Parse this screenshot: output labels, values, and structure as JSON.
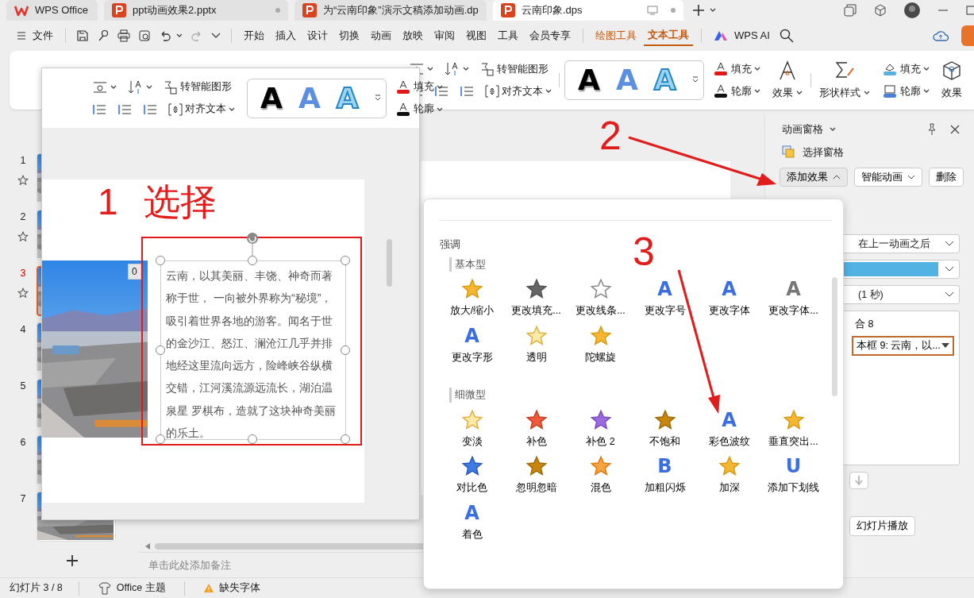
{
  "tabs": [
    {
      "label": "WPS Office",
      "kind": "home",
      "selected": false
    },
    {
      "label": "ppt动画效果2.pptx",
      "kind": "doc",
      "selected": false
    },
    {
      "label": "为“云南印象”演示文稿添加动画.dp",
      "kind": "doc",
      "selected": false
    },
    {
      "label": "云南印象.dps",
      "kind": "doc",
      "selected": true
    }
  ],
  "menu": {
    "file": "文件",
    "quick_access": [
      {
        "kind": "save",
        "disabled": false
      },
      {
        "kind": "key",
        "disabled": false
      },
      {
        "kind": "print",
        "disabled": false
      },
      {
        "kind": "preview",
        "disabled": false
      },
      {
        "kind": "undo",
        "disabled": false
      },
      {
        "kind": "redo",
        "disabled": true
      }
    ],
    "items": [
      {
        "label": "开始",
        "kind": "main",
        "selected": false
      },
      {
        "label": "插入",
        "kind": "main",
        "selected": false
      },
      {
        "label": "设计",
        "kind": "main",
        "selected": false
      },
      {
        "label": "切换",
        "kind": "main",
        "selected": false
      },
      {
        "label": "动画",
        "kind": "main",
        "selected": false
      },
      {
        "label": "放映",
        "kind": "main",
        "selected": false
      },
      {
        "label": "审阅",
        "kind": "main",
        "selected": false
      },
      {
        "label": "视图",
        "kind": "main",
        "selected": false
      },
      {
        "label": "工具",
        "kind": "main",
        "selected": false
      },
      {
        "label": "会员专享",
        "kind": "main",
        "selected": false
      },
      {
        "label": "绘图工具",
        "kind": "context",
        "selected": false
      },
      {
        "label": "文本工具",
        "kind": "context",
        "selected": true
      }
    ],
    "ai": "WPS AI"
  },
  "ribbon": {
    "smart_art": "转智能图形",
    "align_text": "对齐文本",
    "styles": [
      {
        "glyph": "A",
        "kind": "solid"
      },
      {
        "glyph": "A",
        "kind": "gradient"
      },
      {
        "glyph": "A",
        "kind": "outline"
      }
    ],
    "fill": "填充",
    "outline": "轮廓",
    "effects": "效果",
    "shape_styles": "形状样式",
    "shape_fill": "填充",
    "shape_outline": "轮廓",
    "shape_effects": "效果"
  },
  "floating_toolbar": {
    "smart_art": "转智能图形",
    "align_text": "对齐文本",
    "styles": [
      {
        "glyph": "A",
        "kind": "solid"
      },
      {
        "glyph": "A",
        "kind": "gradient"
      },
      {
        "glyph": "A",
        "kind": "outline"
      }
    ],
    "fill": "填充",
    "outline": "轮廓"
  },
  "slides": [
    {
      "number": "1",
      "animated": true,
      "selected": false
    },
    {
      "number": "2",
      "animated": true,
      "selected": false
    },
    {
      "number": "3",
      "animated": true,
      "selected": true
    },
    {
      "number": "4",
      "animated": false,
      "selected": false
    },
    {
      "number": "5",
      "animated": false,
      "selected": false
    },
    {
      "number": "6",
      "animated": false,
      "selected": false
    },
    {
      "number": "7",
      "animated": false,
      "selected": false
    }
  ],
  "slide": {
    "step": "1",
    "title": "选择",
    "badge": "0",
    "body": "云南，以其美丽、丰饶、神奇而著称于世， 一向被外界称为“秘境”，吸引着世界各地的游客。闻名于世的金沙江、怒江、澜沧江几乎并排地经这里流向远方，险峰峡谷纵横交错，江河溪流源远流长，湖泊温泉星 罗棋布，造就了这块神奇美丽的乐土。"
  },
  "notes_placeholder": "单击此处添加备注",
  "animation_pane": {
    "title": "动画窗格",
    "selection_pane": "选择窗格",
    "add_effect": {
      "label": "添加效果",
      "expanded": true
    },
    "smart_animation": "智能动画",
    "delete": "删除",
    "start": "在上一动画之后",
    "color": "#52b3e3",
    "speed": "(1 秒)",
    "list": [
      {
        "label": "合 8",
        "kind": "group",
        "selected": false
      },
      {
        "label": "本框 9: 云南，以...",
        "kind": "item",
        "selected": true
      }
    ],
    "move_down": {
      "disabled": true
    },
    "slideshow": "幻灯片播放"
  },
  "effects_menu": {
    "title": "强调",
    "groups": [
      {
        "label": "基本型",
        "items": [
          {
            "label": "放大/缩小",
            "kind": "star"
          },
          {
            "label": "更改填充...",
            "kind": "star-gray"
          },
          {
            "label": "更改线条...",
            "kind": "star-outline"
          },
          {
            "label": "更改字号",
            "kind": "letter",
            "glyph": "A"
          },
          {
            "label": "更改字体",
            "kind": "letter",
            "glyph": "A"
          },
          {
            "label": "更改字体...",
            "kind": "letter-gray",
            "glyph": "A"
          },
          {
            "label": "更改字形",
            "kind": "letter",
            "glyph": "A"
          },
          {
            "label": "透明",
            "kind": "star-light"
          },
          {
            "label": "陀螺旋",
            "kind": "star"
          }
        ]
      },
      {
        "label": "细微型",
        "items": [
          {
            "label": "变淡",
            "kind": "star-light"
          },
          {
            "label": "补色",
            "kind": "star-red"
          },
          {
            "label": "补色 2",
            "kind": "star-purple"
          },
          {
            "label": "不饱和",
            "kind": "star-brown"
          },
          {
            "label": "彩色波纹",
            "kind": "letter",
            "glyph": "A"
          },
          {
            "label": "垂直突出...",
            "kind": "star"
          },
          {
            "label": "对比色",
            "kind": "star-blue"
          },
          {
            "label": "忽明忽暗",
            "kind": "star-brown"
          },
          {
            "label": "混色",
            "kind": "star-orange"
          },
          {
            "label": "加粗闪烁",
            "kind": "letter",
            "glyph": "B"
          },
          {
            "label": "加深",
            "kind": "star"
          },
          {
            "label": "添加下划线",
            "kind": "letter",
            "glyph": "U"
          },
          {
            "label": "着色",
            "kind": "letter",
            "glyph": "A"
          }
        ]
      }
    ]
  },
  "annotations": [
    {
      "label": "2"
    },
    {
      "label": "3"
    }
  ],
  "status_bar": {
    "slide": "幻灯片 3 / 8",
    "theme": "Office 主题",
    "font_warning": "缺失字体"
  }
}
